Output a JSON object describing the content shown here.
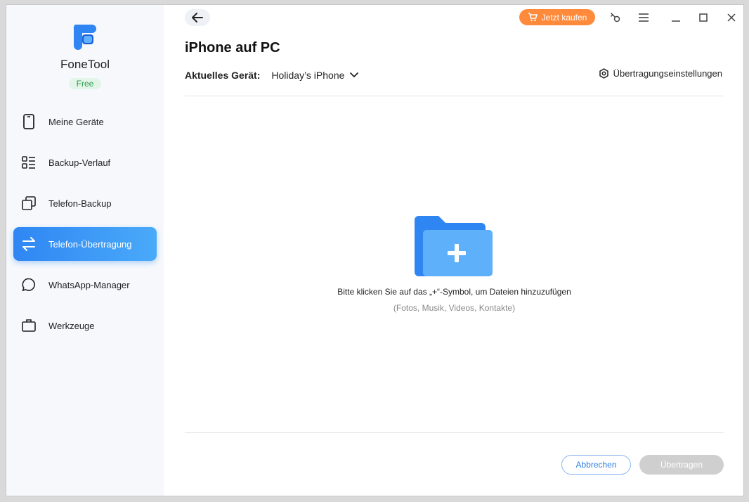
{
  "app": {
    "name": "FoneTool",
    "badge": "Free"
  },
  "sidebar": {
    "items": [
      {
        "label": "Meine Geräte",
        "icon": "phone-icon"
      },
      {
        "label": "Backup-Verlauf",
        "icon": "list-icon"
      },
      {
        "label": "Telefon-Backup",
        "icon": "copy-icon"
      },
      {
        "label": "Telefon-Übertragung",
        "icon": "transfer-icon",
        "active": true
      },
      {
        "label": "WhatsApp-Manager",
        "icon": "chat-icon"
      },
      {
        "label": "Werkzeuge",
        "icon": "briefcase-icon"
      }
    ]
  },
  "header": {
    "buy_label": "Jetzt kaufen"
  },
  "main": {
    "title": "iPhone auf PC",
    "device_label": "Aktuelles Gerät:",
    "device_value": "Holiday’s iPhone",
    "settings_label": "Übertragungseinstellungen",
    "hint": "Bitte klicken Sie auf das „+“-Symbol, um Dateien hinzuzufügen",
    "subhint": "(Fotos, Musik, Videos, Kontakte)"
  },
  "footer": {
    "cancel_label": "Abbrechen",
    "transfer_label": "Übertragen"
  },
  "colors": {
    "accent": "#2f86f3",
    "buy": "#ff8a3c",
    "free_badge": "#2d9a4e"
  }
}
